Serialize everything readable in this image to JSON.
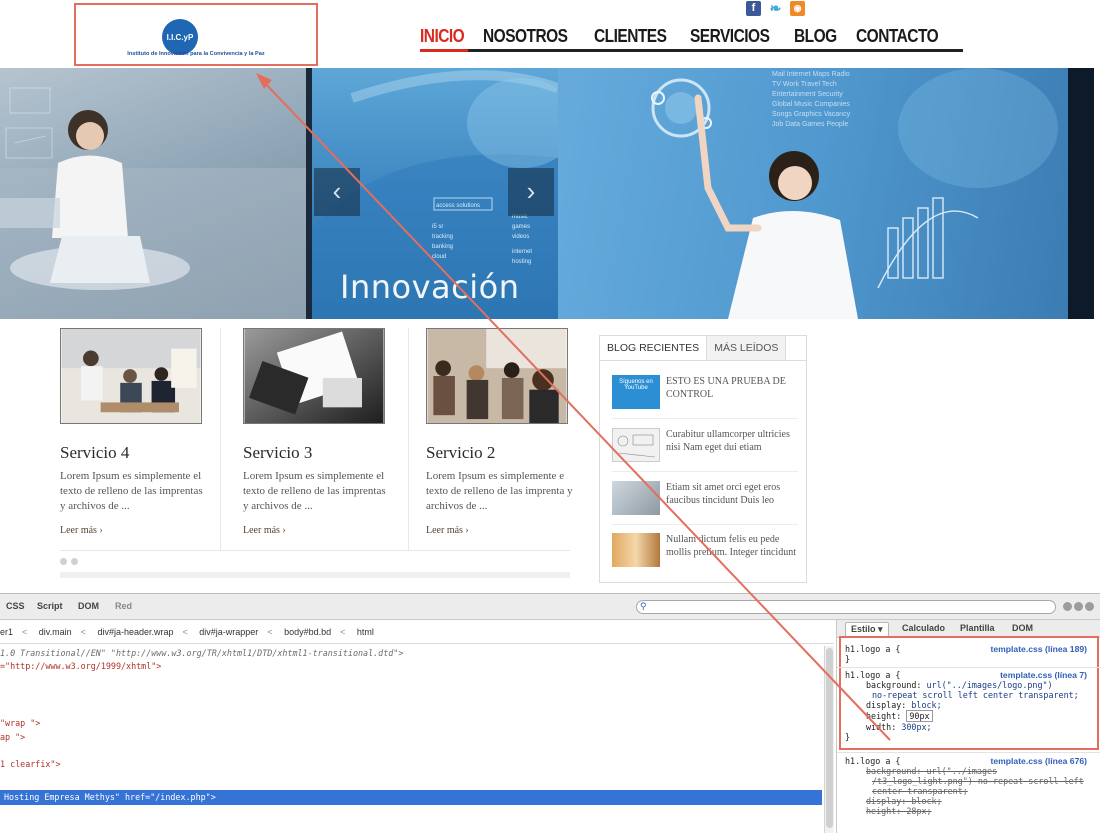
{
  "header": {
    "logo_text": "I.I.C.yP",
    "logo_subtitle": "Instituto de Innovación para la Convivencia y la Paz",
    "social_icons": [
      "facebook-icon",
      "twitter-icon",
      "rss-icon"
    ],
    "nav": [
      "INICIO",
      "NOSOTROS",
      "CLIENTES",
      "SERVICIOS",
      "BLOG",
      "CONTACTO"
    ],
    "active_nav": "INICIO",
    "accent_color": "#d92a1e"
  },
  "hero": {
    "caption": "Innovación",
    "prev_arrow": "‹",
    "next_arrow": "›",
    "screen_text": [
      "Mail Internet Maps Radio",
      "TV Work Travel Tech",
      "Entertainment Security",
      "Global Music Companies",
      "Songs Graphics Vacancy",
      "Job Data Games People"
    ],
    "panel_label": "access solutions"
  },
  "services": [
    {
      "title": "Servicio 4",
      "desc": "Lorem Ipsum es simplemente el texto de relleno de las imprentas y archivos de ...",
      "more": "Leer más ›"
    },
    {
      "title": "Servicio 3",
      "desc": "Lorem Ipsum es simplemente el texto de relleno de las imprentas y archivos de ...",
      "more": "Leer más ›"
    },
    {
      "title": "Servicio 2",
      "desc": "Lorem Ipsum es simplemente e texto de relleno de las imprenta y archivos de ...",
      "more": "Leer más ›"
    }
  ],
  "blog": {
    "tabs": [
      "BLOG RECIENTES",
      "MÁS LEÍDOS"
    ],
    "items": [
      {
        "text": "ESTO ES UNA PRUEBA DE CONTROL",
        "thumb_label": "Síguenos en YouTube"
      },
      {
        "text": "Curabitur ullamcorper ultricies nisi Nam eget dui etiam"
      },
      {
        "text": "Etiam sit amet orci eget eros faucibus tincidunt Duis leo"
      },
      {
        "text": "Nullam dictum felis eu pede mollis pretium. Integer tincidunt"
      }
    ]
  },
  "devtools": {
    "tabs": [
      "CSS",
      "Script",
      "DOM",
      "Red"
    ],
    "breadcrumbs": [
      "er1",
      "div.main",
      "div#ja-header.wrap",
      "div#ja-wrapper",
      "body#bd.bd",
      "html"
    ],
    "source_lines": [
      {
        "text": "1.0 Transitional//EN\" \"http://www.w3.org/TR/xhtml1/DTD/xhtml1-transitional.dtd\">",
        "kind": "cmt"
      },
      {
        "text": "=\"http://www.w3.org/1999/xhtml\">",
        "kind": "str"
      },
      {
        "text": "\"wrap \">",
        "kind": "str"
      },
      {
        "text": "ap \">",
        "kind": "str"
      },
      {
        "text": "1 clearfix\">",
        "kind": "str"
      },
      {
        "text": " Hosting Empresa Methys\" href=\"/index.php\">",
        "kind": "sel"
      }
    ],
    "side_tabs": [
      "Estilo ▾",
      "Calculado",
      "Plantilla",
      "DOM"
    ],
    "rules": [
      {
        "selector": "h1.logo a {",
        "source": "template.css (línea 189)",
        "props": [],
        "close": "}"
      },
      {
        "selector": "h1.logo a {",
        "source": "template.css (línea 7)",
        "props": [
          {
            "name": "background",
            "value": "url(\"../images/logo.png\")"
          },
          {
            "name": "",
            "value": "no-repeat scroll left center transparent;"
          },
          {
            "name": "display",
            "value": "block;"
          },
          {
            "name": "height",
            "value": "90px"
          },
          {
            "name": "width",
            "value": "300px;"
          }
        ],
        "close": "}"
      },
      {
        "selector": "h1.logo a {",
        "source": "template.css (línea 676)",
        "props": [
          {
            "name": "background",
            "value": "url(\"../images"
          },
          {
            "name": "",
            "value": "/t3_logo_light.png\") no-repeat scroll left"
          },
          {
            "name": "",
            "value": "center transparent;"
          },
          {
            "name": "display",
            "value": "block;"
          },
          {
            "name": "height",
            "value": "28px;"
          }
        ],
        "close": ""
      }
    ]
  }
}
